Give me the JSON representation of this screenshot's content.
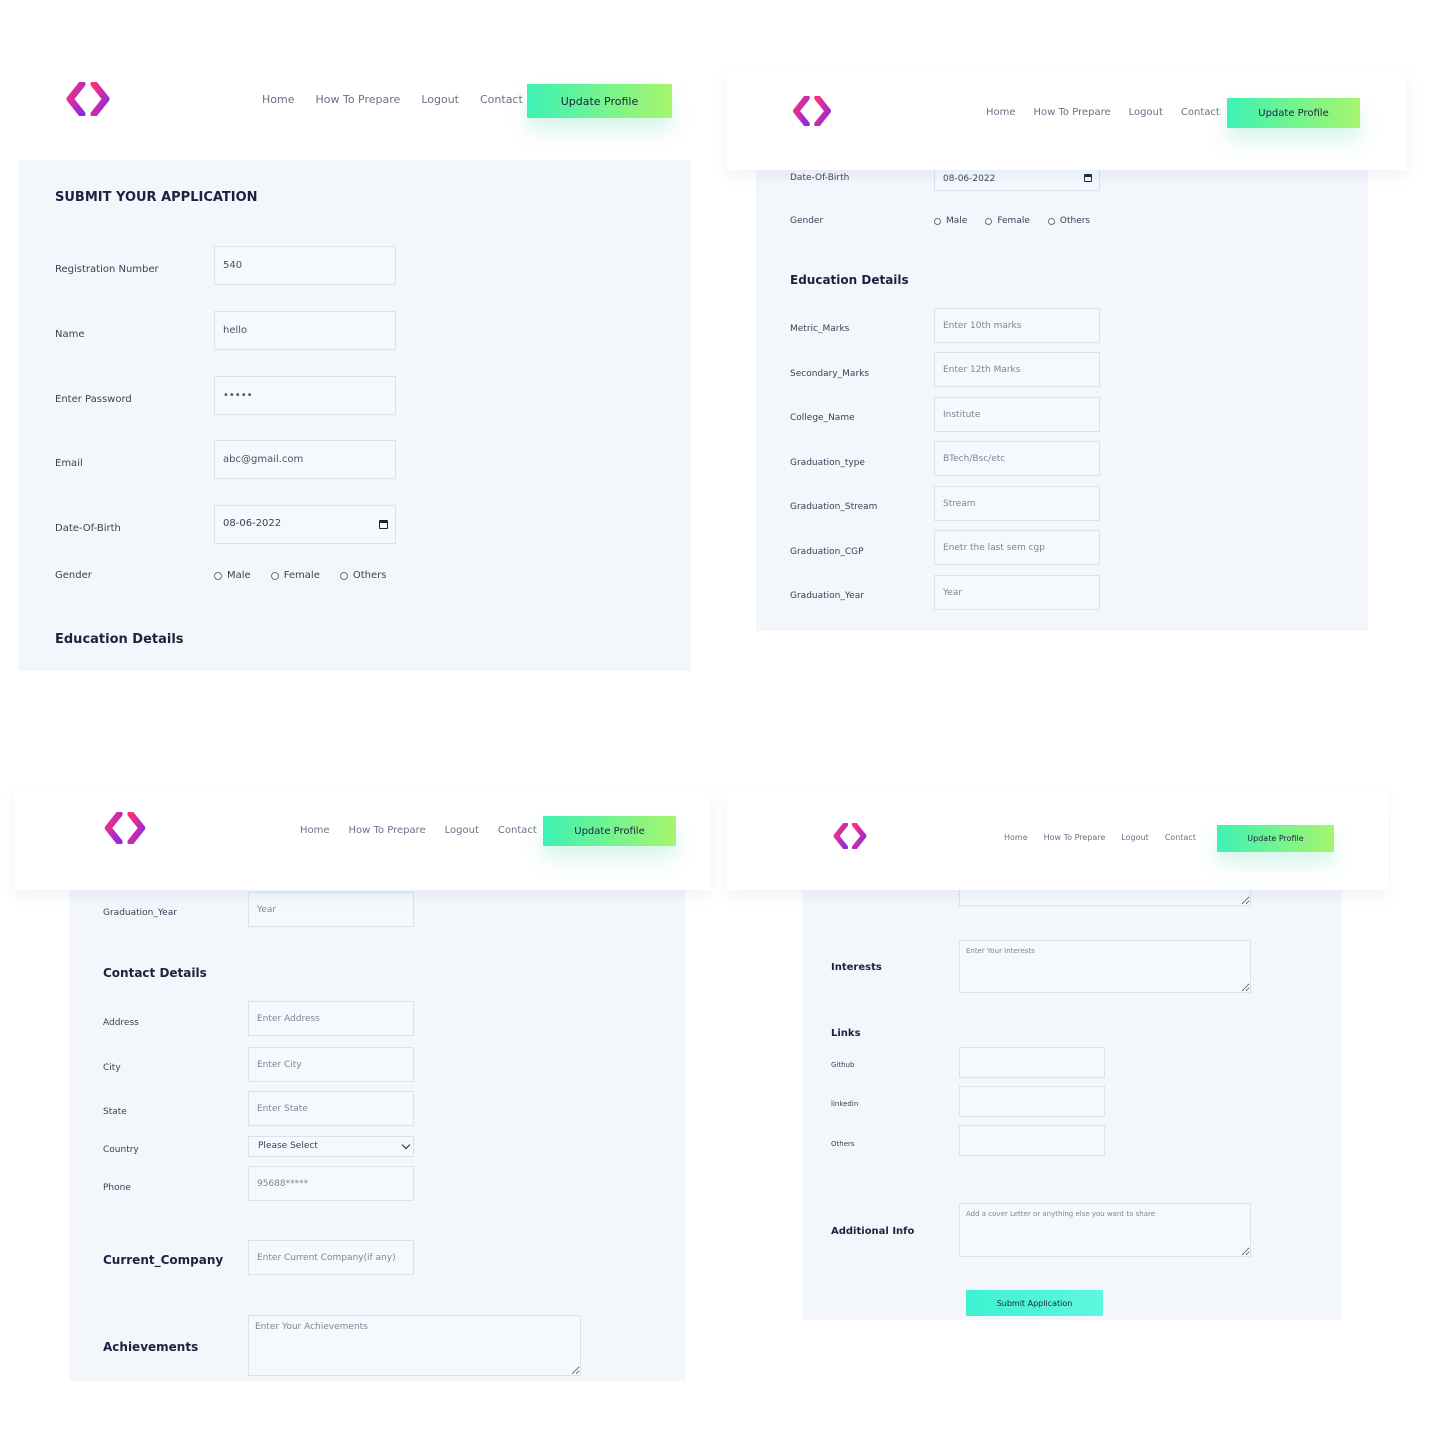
{
  "nav": {
    "home": "Home",
    "how_to_prepare": "How To Prepare",
    "logout": "Logout",
    "contact": "Contact",
    "update_profile": "Update Profile"
  },
  "brand": {
    "logo_colors": [
      "#ff2f7a",
      "#8a2be2"
    ],
    "accent": "#3ef2b4"
  },
  "form": {
    "title": "SUBMIT YOUR APPLICATION",
    "registration": {
      "label": "Registration Number",
      "value": "540"
    },
    "name": {
      "label": "Name",
      "value": "hello"
    },
    "password": {
      "label": "Enter Password",
      "value": "•••••"
    },
    "email": {
      "label": "Email",
      "value": "abc@gmail.com"
    },
    "dob": {
      "label": "Date-Of-Birth",
      "value": "08-06-2022"
    },
    "gender": {
      "label": "Gender",
      "options": [
        "Male",
        "Female",
        "Others"
      ]
    },
    "education": {
      "heading": "Education Details",
      "metric_marks": {
        "label": "Metric_Marks",
        "placeholder": "Enter 10th marks"
      },
      "secondary_marks": {
        "label": "Secondary_Marks",
        "placeholder": "Enter 12th Marks"
      },
      "college_name": {
        "label": "College_Name",
        "placeholder": "Institute"
      },
      "graduation_type": {
        "label": "Graduation_type",
        "placeholder": "BTech/Bsc/etc"
      },
      "graduation_stream": {
        "label": "Graduation_Stream",
        "placeholder": "Stream"
      },
      "graduation_cgp": {
        "label": "Graduation_CGP",
        "placeholder": "Enetr the last sem cgp"
      },
      "graduation_year": {
        "label": "Graduation_Year",
        "placeholder": "Year"
      }
    },
    "contact": {
      "heading": "Contact Details",
      "address": {
        "label": "Address",
        "placeholder": "Enter Address"
      },
      "city": {
        "label": "City",
        "placeholder": "Enter City"
      },
      "state": {
        "label": "State",
        "placeholder": "Enter State"
      },
      "country": {
        "label": "Country",
        "selected": "Please Select"
      },
      "phone": {
        "label": "Phone",
        "placeholder": "95688*****"
      }
    },
    "current_company": {
      "label": "Current_Company",
      "placeholder": "Enter Current Company(if any)"
    },
    "achievements": {
      "label": "Achievements",
      "placeholder": "Enter Your Achievements"
    },
    "interests": {
      "label": "Interests",
      "placeholder": "Enter Your Interests"
    },
    "links": {
      "heading": "Links",
      "github": "Github",
      "linkedin": "linkedin",
      "others": "Others"
    },
    "additional_info": {
      "label": "Additional Info",
      "placeholder": "Add a cover Letter or anything else you want to share"
    },
    "submit": "Submit Application"
  }
}
